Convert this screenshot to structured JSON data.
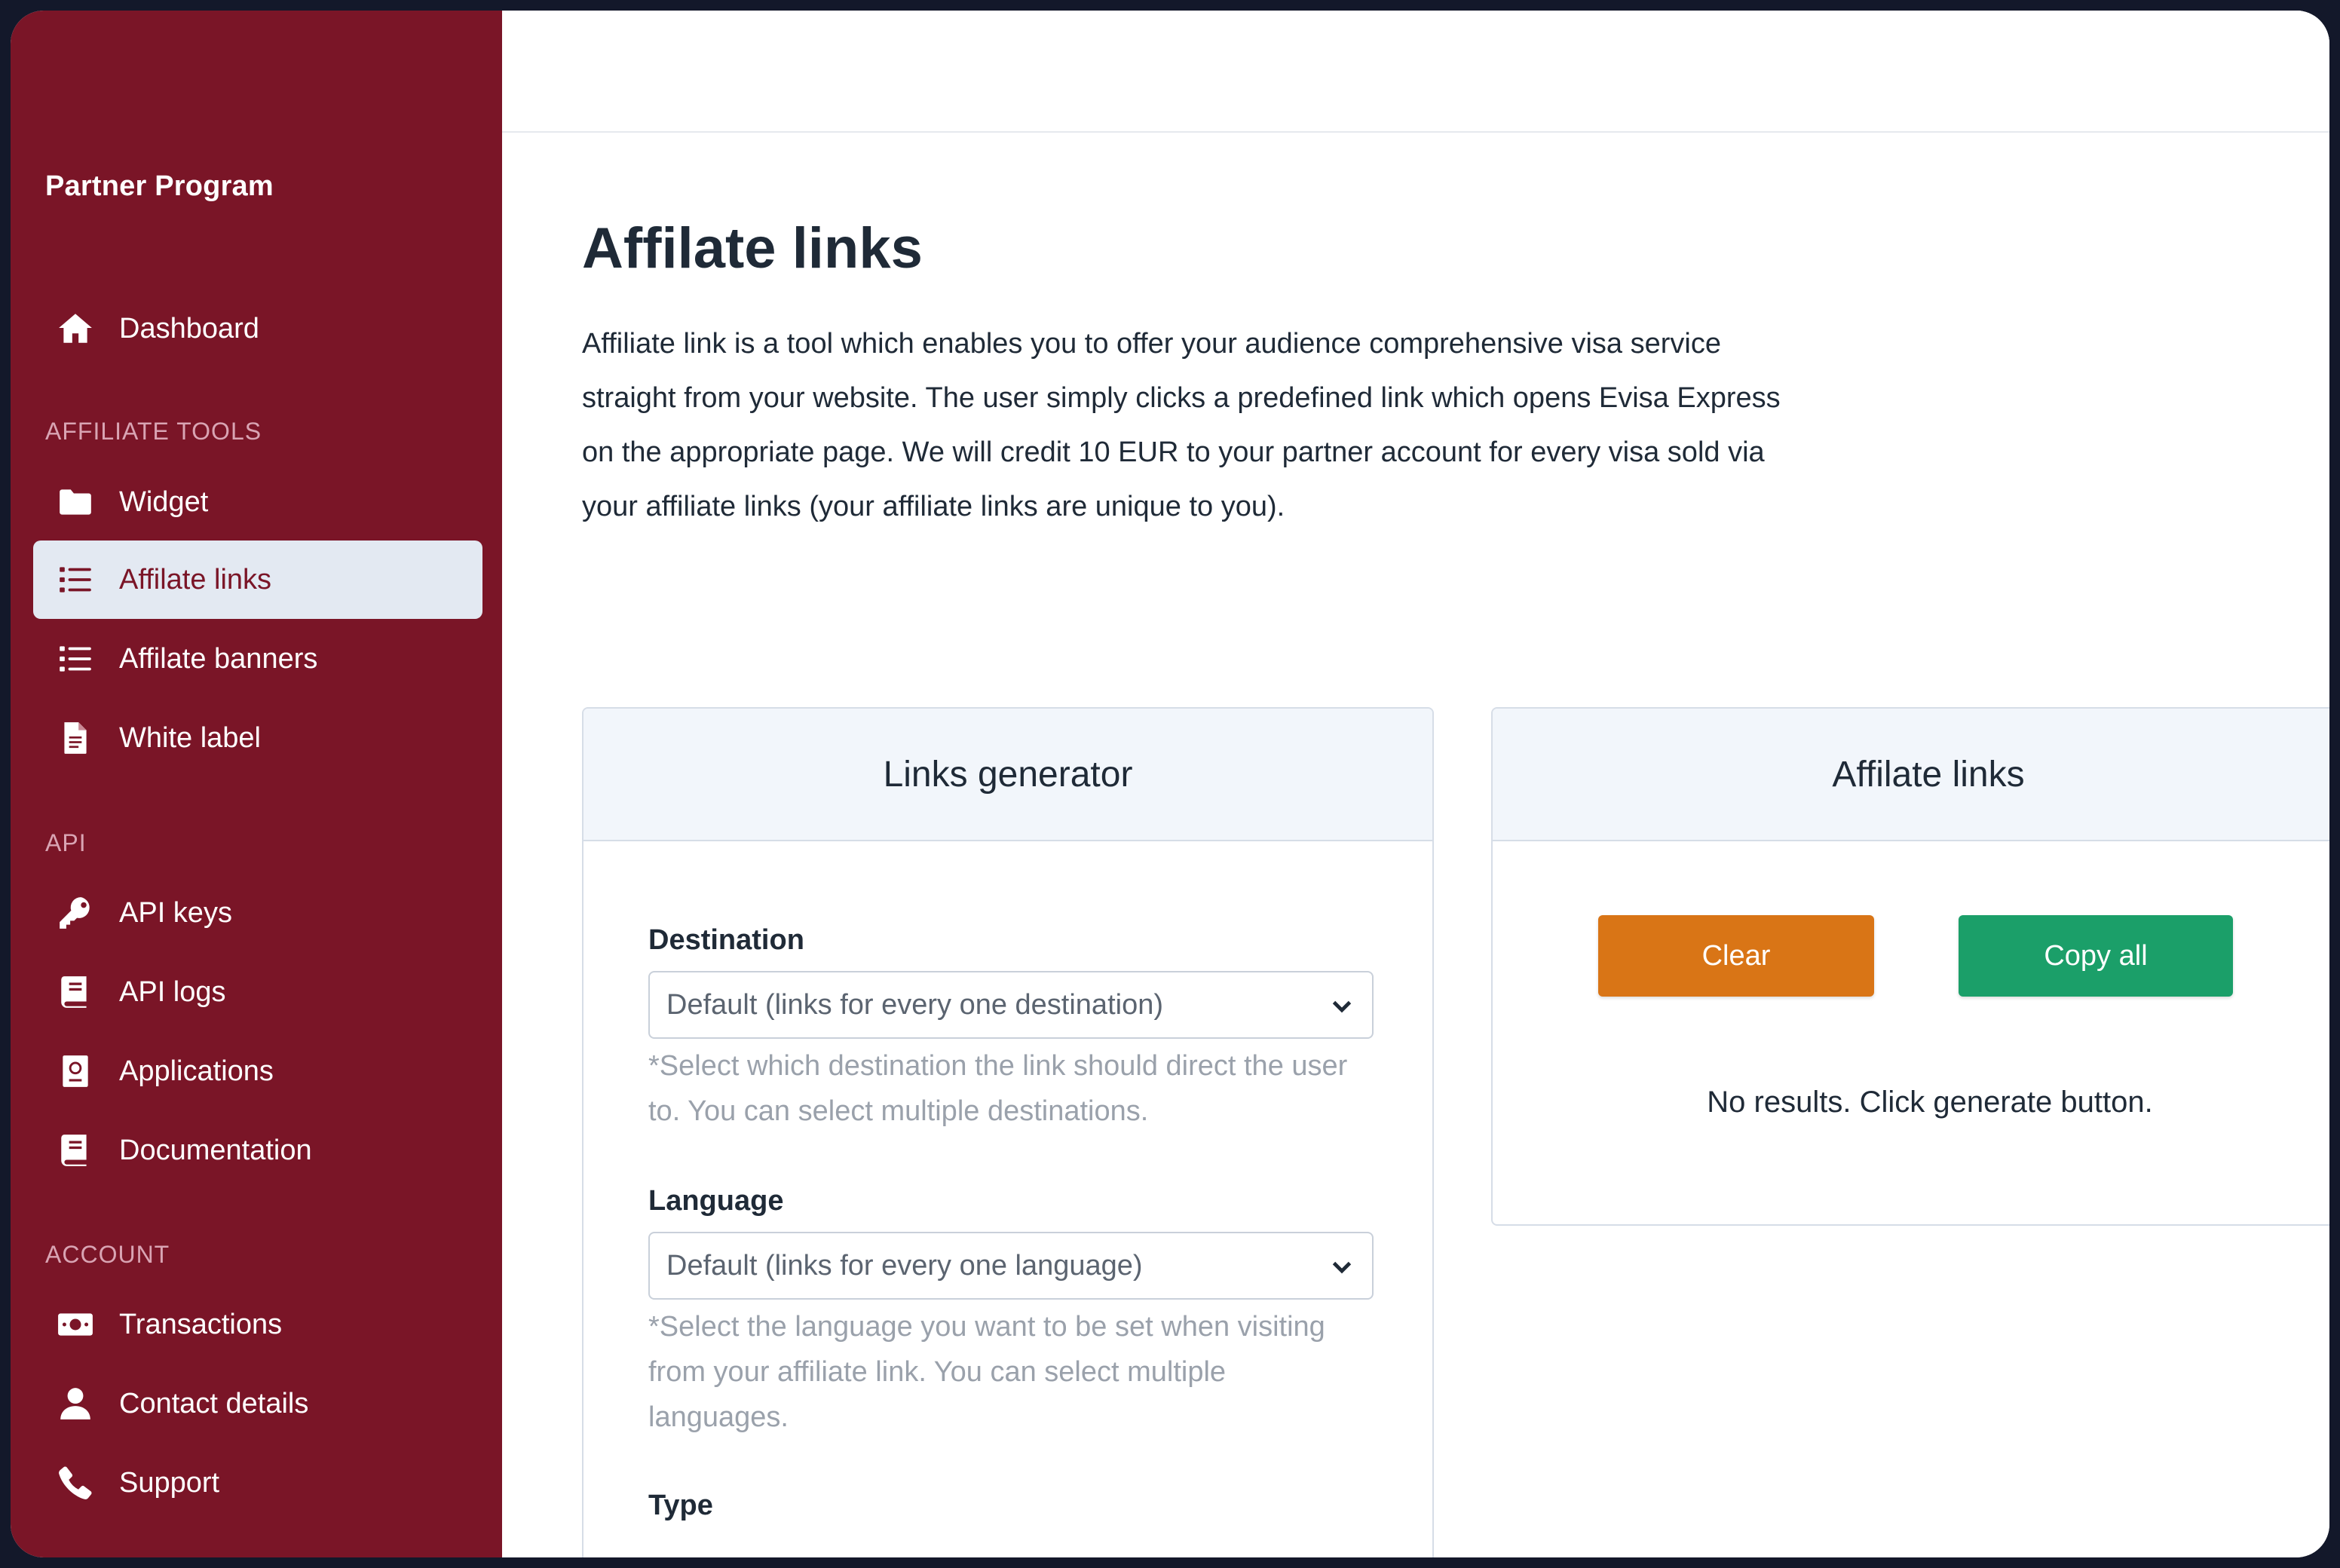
{
  "sidebar": {
    "brand": "Partner Program",
    "sections": {
      "affiliate_tools": "AFFILIATE TOOLS",
      "api": "API",
      "account": "ACCOUNT"
    },
    "items": [
      {
        "label": "Dashboard",
        "icon": "home-icon"
      },
      {
        "label": "Widget",
        "icon": "folder-icon"
      },
      {
        "label": "Affilate links",
        "icon": "list-icon",
        "active": true
      },
      {
        "label": "Affilate banners",
        "icon": "list-icon"
      },
      {
        "label": "White label",
        "icon": "document-icon"
      },
      {
        "label": "API keys",
        "icon": "key-icon"
      },
      {
        "label": "API logs",
        "icon": "book-icon"
      },
      {
        "label": "Applications",
        "icon": "passport-icon"
      },
      {
        "label": "Documentation",
        "icon": "book-icon"
      },
      {
        "label": "Transactions",
        "icon": "money-icon"
      },
      {
        "label": "Contact details",
        "icon": "user-icon"
      },
      {
        "label": "Support",
        "icon": "phone-icon"
      }
    ]
  },
  "main": {
    "title": "Affilate links",
    "intro": "Affiliate link is a tool which enables you to offer your audience comprehensive visa service straight from your website. The user simply clicks a predefined link which opens Evisa Express on the appropriate page. We will credit 10 EUR to your partner account for every visa sold via your affiliate links (your affiliate links are unique to you).",
    "generator": {
      "header": "Links generator",
      "destination_label": "Destination",
      "destination_value": "Default (links for every one destination)",
      "destination_help": "*Select which destination the link should direct the user to. You can select multiple destinations.",
      "language_label": "Language",
      "language_value": "Default (links for every one language)",
      "language_help": "*Select the language you want to be set when visiting from your affiliate link. You can select multiple languages.",
      "type_label": "Type"
    },
    "affiliate": {
      "header": "Affilate links",
      "clear_label": "Clear",
      "copy_label": "Copy all",
      "empty_text": "No results. Click generate button."
    }
  },
  "colors": {
    "sidebar_bg": "#7a1527",
    "active_item_bg": "#e3e9f2",
    "clear_button": "#d97516",
    "copy_button": "#1b9f69"
  }
}
